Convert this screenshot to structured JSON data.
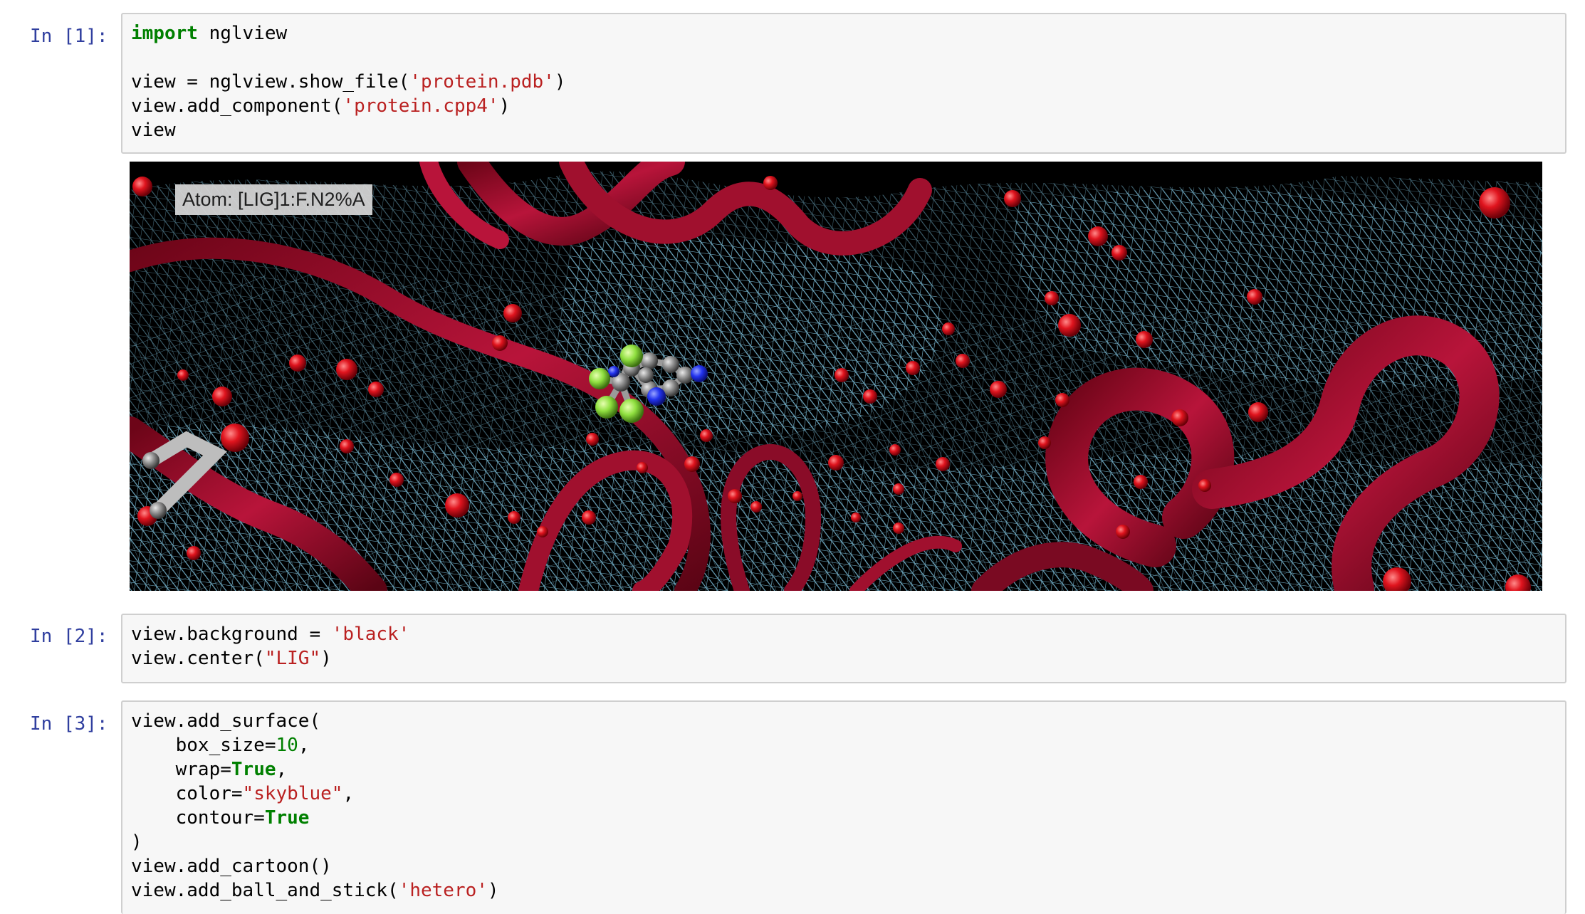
{
  "cells": [
    {
      "prompt": "In [1]:",
      "lines": [
        [
          {
            "t": "kw",
            "v": "import"
          },
          {
            "t": "",
            "v": " nglview"
          }
        ],
        [],
        [
          {
            "t": "",
            "v": "view = nglview.show_file("
          },
          {
            "t": "str",
            "v": "'protein.pdb'"
          },
          {
            "t": "",
            "v": ")"
          }
        ],
        [
          {
            "t": "",
            "v": "view.add_component("
          },
          {
            "t": "str",
            "v": "'protein.cpp4'"
          },
          {
            "t": "",
            "v": ")"
          }
        ],
        [
          {
            "t": "",
            "v": "view"
          }
        ]
      ]
    },
    {
      "prompt": "In [2]:",
      "lines": [
        [
          {
            "t": "",
            "v": "view.background = "
          },
          {
            "t": "str",
            "v": "'black'"
          }
        ],
        [
          {
            "t": "",
            "v": "view.center("
          },
          {
            "t": "str",
            "v": "\"LIG\""
          },
          {
            "t": "",
            "v": ")"
          }
        ]
      ]
    },
    {
      "prompt": "In [3]:",
      "lines": [
        [
          {
            "t": "",
            "v": "view.add_surface("
          }
        ],
        [
          {
            "t": "",
            "v": "    box_size="
          },
          {
            "t": "num",
            "v": "10"
          },
          {
            "t": "",
            "v": ","
          }
        ],
        [
          {
            "t": "",
            "v": "    wrap="
          },
          {
            "t": "kw",
            "v": "True"
          },
          {
            "t": "",
            "v": ","
          }
        ],
        [
          {
            "t": "",
            "v": "    color="
          },
          {
            "t": "str",
            "v": "\"skyblue\""
          },
          {
            "t": "",
            "v": ","
          }
        ],
        [
          {
            "t": "",
            "v": "    contour="
          },
          {
            "t": "kw",
            "v": "True"
          }
        ],
        [
          {
            "t": "",
            "v": ")"
          }
        ],
        [
          {
            "t": "",
            "v": "view.add_cartoon()"
          }
        ],
        [
          {
            "t": "",
            "v": "view.add_ball_and_stick("
          },
          {
            "t": "str",
            "v": "'hetero'"
          },
          {
            "t": "",
            "v": ")"
          }
        ]
      ]
    }
  ],
  "viewer": {
    "tooltip": "Atom: [LIG]1:F.N2%A",
    "background": "#000000",
    "surface_color": "#87ceeb",
    "cartoon_color": "#a0102e",
    "water_color": "#e0141e",
    "ligand": {
      "carbon": "#8f8f8f",
      "nitrogen": "#2233ee",
      "fluorine": "#90e040"
    }
  }
}
